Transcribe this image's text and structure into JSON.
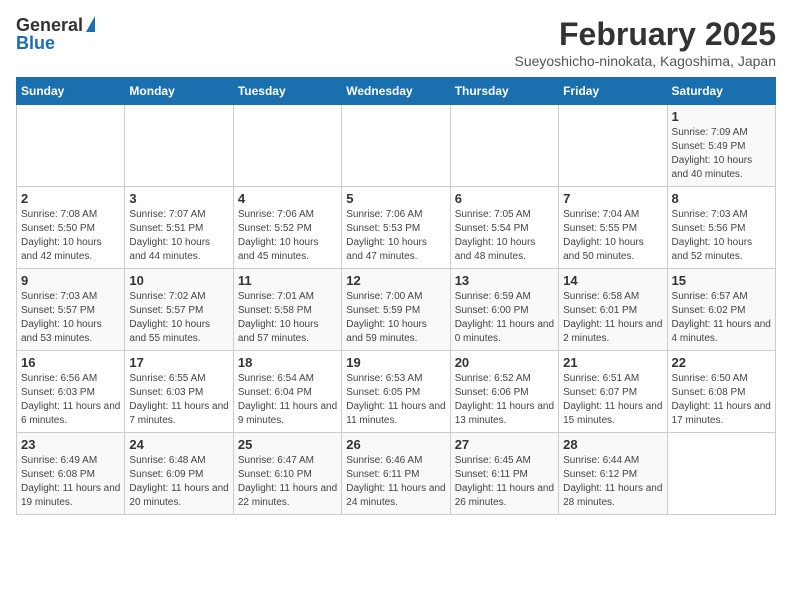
{
  "header": {
    "logo_general": "General",
    "logo_blue": "Blue",
    "month_title": "February 2025",
    "location": "Sueyoshicho-ninokata, Kagoshima, Japan"
  },
  "calendar": {
    "days_of_week": [
      "Sunday",
      "Monday",
      "Tuesday",
      "Wednesday",
      "Thursday",
      "Friday",
      "Saturday"
    ],
    "weeks": [
      [
        {
          "day": "",
          "info": ""
        },
        {
          "day": "",
          "info": ""
        },
        {
          "day": "",
          "info": ""
        },
        {
          "day": "",
          "info": ""
        },
        {
          "day": "",
          "info": ""
        },
        {
          "day": "",
          "info": ""
        },
        {
          "day": "1",
          "info": "Sunrise: 7:09 AM\nSunset: 5:49 PM\nDaylight: 10 hours and 40 minutes."
        }
      ],
      [
        {
          "day": "2",
          "info": "Sunrise: 7:08 AM\nSunset: 5:50 PM\nDaylight: 10 hours and 42 minutes."
        },
        {
          "day": "3",
          "info": "Sunrise: 7:07 AM\nSunset: 5:51 PM\nDaylight: 10 hours and 44 minutes."
        },
        {
          "day": "4",
          "info": "Sunrise: 7:06 AM\nSunset: 5:52 PM\nDaylight: 10 hours and 45 minutes."
        },
        {
          "day": "5",
          "info": "Sunrise: 7:06 AM\nSunset: 5:53 PM\nDaylight: 10 hours and 47 minutes."
        },
        {
          "day": "6",
          "info": "Sunrise: 7:05 AM\nSunset: 5:54 PM\nDaylight: 10 hours and 48 minutes."
        },
        {
          "day": "7",
          "info": "Sunrise: 7:04 AM\nSunset: 5:55 PM\nDaylight: 10 hours and 50 minutes."
        },
        {
          "day": "8",
          "info": "Sunrise: 7:03 AM\nSunset: 5:56 PM\nDaylight: 10 hours and 52 minutes."
        }
      ],
      [
        {
          "day": "9",
          "info": "Sunrise: 7:03 AM\nSunset: 5:57 PM\nDaylight: 10 hours and 53 minutes."
        },
        {
          "day": "10",
          "info": "Sunrise: 7:02 AM\nSunset: 5:57 PM\nDaylight: 10 hours and 55 minutes."
        },
        {
          "day": "11",
          "info": "Sunrise: 7:01 AM\nSunset: 5:58 PM\nDaylight: 10 hours and 57 minutes."
        },
        {
          "day": "12",
          "info": "Sunrise: 7:00 AM\nSunset: 5:59 PM\nDaylight: 10 hours and 59 minutes."
        },
        {
          "day": "13",
          "info": "Sunrise: 6:59 AM\nSunset: 6:00 PM\nDaylight: 11 hours and 0 minutes."
        },
        {
          "day": "14",
          "info": "Sunrise: 6:58 AM\nSunset: 6:01 PM\nDaylight: 11 hours and 2 minutes."
        },
        {
          "day": "15",
          "info": "Sunrise: 6:57 AM\nSunset: 6:02 PM\nDaylight: 11 hours and 4 minutes."
        }
      ],
      [
        {
          "day": "16",
          "info": "Sunrise: 6:56 AM\nSunset: 6:03 PM\nDaylight: 11 hours and 6 minutes."
        },
        {
          "day": "17",
          "info": "Sunrise: 6:55 AM\nSunset: 6:03 PM\nDaylight: 11 hours and 7 minutes."
        },
        {
          "day": "18",
          "info": "Sunrise: 6:54 AM\nSunset: 6:04 PM\nDaylight: 11 hours and 9 minutes."
        },
        {
          "day": "19",
          "info": "Sunrise: 6:53 AM\nSunset: 6:05 PM\nDaylight: 11 hours and 11 minutes."
        },
        {
          "day": "20",
          "info": "Sunrise: 6:52 AM\nSunset: 6:06 PM\nDaylight: 11 hours and 13 minutes."
        },
        {
          "day": "21",
          "info": "Sunrise: 6:51 AM\nSunset: 6:07 PM\nDaylight: 11 hours and 15 minutes."
        },
        {
          "day": "22",
          "info": "Sunrise: 6:50 AM\nSunset: 6:08 PM\nDaylight: 11 hours and 17 minutes."
        }
      ],
      [
        {
          "day": "23",
          "info": "Sunrise: 6:49 AM\nSunset: 6:08 PM\nDaylight: 11 hours and 19 minutes."
        },
        {
          "day": "24",
          "info": "Sunrise: 6:48 AM\nSunset: 6:09 PM\nDaylight: 11 hours and 20 minutes."
        },
        {
          "day": "25",
          "info": "Sunrise: 6:47 AM\nSunset: 6:10 PM\nDaylight: 11 hours and 22 minutes."
        },
        {
          "day": "26",
          "info": "Sunrise: 6:46 AM\nSunset: 6:11 PM\nDaylight: 11 hours and 24 minutes."
        },
        {
          "day": "27",
          "info": "Sunrise: 6:45 AM\nSunset: 6:11 PM\nDaylight: 11 hours and 26 minutes."
        },
        {
          "day": "28",
          "info": "Sunrise: 6:44 AM\nSunset: 6:12 PM\nDaylight: 11 hours and 28 minutes."
        },
        {
          "day": "",
          "info": ""
        }
      ]
    ]
  }
}
